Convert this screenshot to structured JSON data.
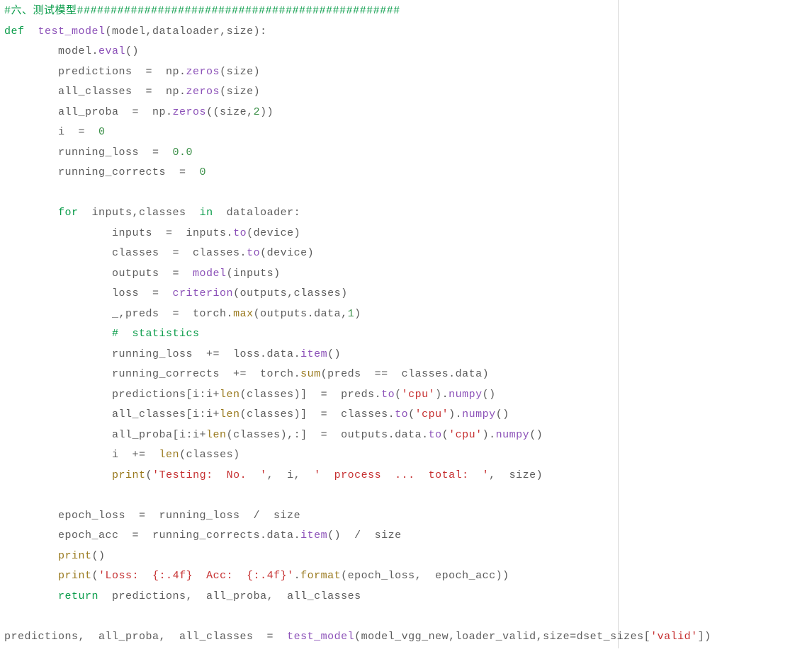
{
  "lines": [
    [
      {
        "c": "tk-cm",
        "t": "#六、测试模型################################################"
      }
    ],
    [
      {
        "c": "tk-kw",
        "t": "def"
      },
      {
        "c": "",
        "t": "  "
      },
      {
        "c": "tk-fn",
        "t": "test_model"
      },
      {
        "c": "tk-id",
        "t": "(model,dataloader,size)"
      },
      {
        "c": "tk-pn",
        "t": ":"
      }
    ],
    [
      {
        "c": "",
        "t": "        model."
      },
      {
        "c": "tk-fn",
        "t": "eval"
      },
      {
        "c": "",
        "t": "()"
      }
    ],
    [
      {
        "c": "",
        "t": "        predictions  =  np."
      },
      {
        "c": "tk-fn",
        "t": "zeros"
      },
      {
        "c": "",
        "t": "(size)"
      }
    ],
    [
      {
        "c": "",
        "t": "        all_classes  =  np."
      },
      {
        "c": "tk-fn",
        "t": "zeros"
      },
      {
        "c": "",
        "t": "(size)"
      }
    ],
    [
      {
        "c": "",
        "t": "        all_proba  =  np."
      },
      {
        "c": "tk-fn",
        "t": "zeros"
      },
      {
        "c": "",
        "t": "((size,"
      },
      {
        "c": "tk-nm",
        "t": "2"
      },
      {
        "c": "",
        "t": "))"
      }
    ],
    [
      {
        "c": "",
        "t": "        i  =  "
      },
      {
        "c": "tk-nm",
        "t": "0"
      }
    ],
    [
      {
        "c": "",
        "t": "        running_loss  =  "
      },
      {
        "c": "tk-nm",
        "t": "0.0"
      }
    ],
    [
      {
        "c": "",
        "t": "        running_corrects  =  "
      },
      {
        "c": "tk-nm",
        "t": "0"
      }
    ],
    [
      {
        "c": "",
        "t": ""
      }
    ],
    [
      {
        "c": "",
        "t": "        "
      },
      {
        "c": "tk-kw",
        "t": "for"
      },
      {
        "c": "",
        "t": "  inputs,classes  "
      },
      {
        "c": "tk-kw",
        "t": "in"
      },
      {
        "c": "",
        "t": "  dataloader:"
      }
    ],
    [
      {
        "c": "",
        "t": "                inputs  =  inputs."
      },
      {
        "c": "tk-fn",
        "t": "to"
      },
      {
        "c": "",
        "t": "(device)"
      }
    ],
    [
      {
        "c": "",
        "t": "                classes  =  classes."
      },
      {
        "c": "tk-fn",
        "t": "to"
      },
      {
        "c": "",
        "t": "(device)"
      }
    ],
    [
      {
        "c": "",
        "t": "                outputs  =  "
      },
      {
        "c": "tk-fn",
        "t": "model"
      },
      {
        "c": "",
        "t": "(inputs)"
      }
    ],
    [
      {
        "c": "",
        "t": "                loss  =  "
      },
      {
        "c": "tk-fn",
        "t": "criterion"
      },
      {
        "c": "",
        "t": "(outputs,classes)"
      }
    ],
    [
      {
        "c": "",
        "t": "                _,preds  =  torch."
      },
      {
        "c": "tk-bt",
        "t": "max"
      },
      {
        "c": "",
        "t": "(outputs.data,"
      },
      {
        "c": "tk-nm",
        "t": "1"
      },
      {
        "c": "",
        "t": ")"
      }
    ],
    [
      {
        "c": "",
        "t": "                "
      },
      {
        "c": "tk-cm",
        "t": "#  statistics"
      }
    ],
    [
      {
        "c": "",
        "t": "                running_loss  +=  loss.data."
      },
      {
        "c": "tk-fn",
        "t": "item"
      },
      {
        "c": "",
        "t": "()"
      }
    ],
    [
      {
        "c": "",
        "t": "                running_corrects  +=  torch."
      },
      {
        "c": "tk-bt",
        "t": "sum"
      },
      {
        "c": "",
        "t": "(preds  ==  classes.data)"
      }
    ],
    [
      {
        "c": "",
        "t": "                predictions[i:i+"
      },
      {
        "c": "tk-bt",
        "t": "len"
      },
      {
        "c": "",
        "t": "(classes)]  =  preds."
      },
      {
        "c": "tk-fn",
        "t": "to"
      },
      {
        "c": "",
        "t": "("
      },
      {
        "c": "tk-st",
        "t": "'cpu'"
      },
      {
        "c": "",
        "t": ")."
      },
      {
        "c": "tk-fn",
        "t": "numpy"
      },
      {
        "c": "",
        "t": "()"
      }
    ],
    [
      {
        "c": "",
        "t": "                all_classes[i:i+"
      },
      {
        "c": "tk-bt",
        "t": "len"
      },
      {
        "c": "",
        "t": "(classes)]  =  classes."
      },
      {
        "c": "tk-fn",
        "t": "to"
      },
      {
        "c": "",
        "t": "("
      },
      {
        "c": "tk-st",
        "t": "'cpu'"
      },
      {
        "c": "",
        "t": ")."
      },
      {
        "c": "tk-fn",
        "t": "numpy"
      },
      {
        "c": "",
        "t": "()"
      }
    ],
    [
      {
        "c": "",
        "t": "                all_proba[i:i+"
      },
      {
        "c": "tk-bt",
        "t": "len"
      },
      {
        "c": "",
        "t": "(classes),:]  =  outputs.data."
      },
      {
        "c": "tk-fn",
        "t": "to"
      },
      {
        "c": "",
        "t": "("
      },
      {
        "c": "tk-st",
        "t": "'cpu'"
      },
      {
        "c": "",
        "t": ")."
      },
      {
        "c": "tk-fn",
        "t": "numpy"
      },
      {
        "c": "",
        "t": "()"
      }
    ],
    [
      {
        "c": "",
        "t": "                i  +=  "
      },
      {
        "c": "tk-bt",
        "t": "len"
      },
      {
        "c": "",
        "t": "(classes)"
      }
    ],
    [
      {
        "c": "",
        "t": "                "
      },
      {
        "c": "tk-bt",
        "t": "print"
      },
      {
        "c": "",
        "t": "("
      },
      {
        "c": "tk-st",
        "t": "'Testing:  No.  '"
      },
      {
        "c": "",
        "t": ",  i,  "
      },
      {
        "c": "tk-st",
        "t": "'  process  ...  total:  '"
      },
      {
        "c": "",
        "t": ",  size)"
      }
    ],
    [
      {
        "c": "",
        "t": "                "
      }
    ],
    [
      {
        "c": "",
        "t": "        epoch_loss  =  running_loss  /  size"
      }
    ],
    [
      {
        "c": "",
        "t": "        epoch_acc  =  running_corrects.data."
      },
      {
        "c": "tk-fn",
        "t": "item"
      },
      {
        "c": "",
        "t": "()  /  size"
      }
    ],
    [
      {
        "c": "",
        "t": "        "
      },
      {
        "c": "tk-bt",
        "t": "print"
      },
      {
        "c": "",
        "t": "()"
      }
    ],
    [
      {
        "c": "",
        "t": "        "
      },
      {
        "c": "tk-bt",
        "t": "print"
      },
      {
        "c": "",
        "t": "("
      },
      {
        "c": "tk-st",
        "t": "'Loss:  {:.4f}  Acc:  {:.4f}'"
      },
      {
        "c": "",
        "t": "."
      },
      {
        "c": "tk-bt",
        "t": "format"
      },
      {
        "c": "",
        "t": "(epoch_loss,  epoch_acc))"
      }
    ],
    [
      {
        "c": "",
        "t": "        "
      },
      {
        "c": "tk-kw",
        "t": "return"
      },
      {
        "c": "",
        "t": "  predictions,  all_proba,  all_classes"
      }
    ],
    [
      {
        "c": "",
        "t": ""
      }
    ],
    [
      {
        "c": "",
        "t": "predictions,  all_proba,  all_classes  =  "
      },
      {
        "c": "tk-fn",
        "t": "test_model"
      },
      {
        "c": "",
        "t": "(model_vgg_new,loader_valid,size=dset_sizes["
      },
      {
        "c": "tk-st",
        "t": "'valid'"
      },
      {
        "c": "",
        "t": "])"
      }
    ]
  ]
}
